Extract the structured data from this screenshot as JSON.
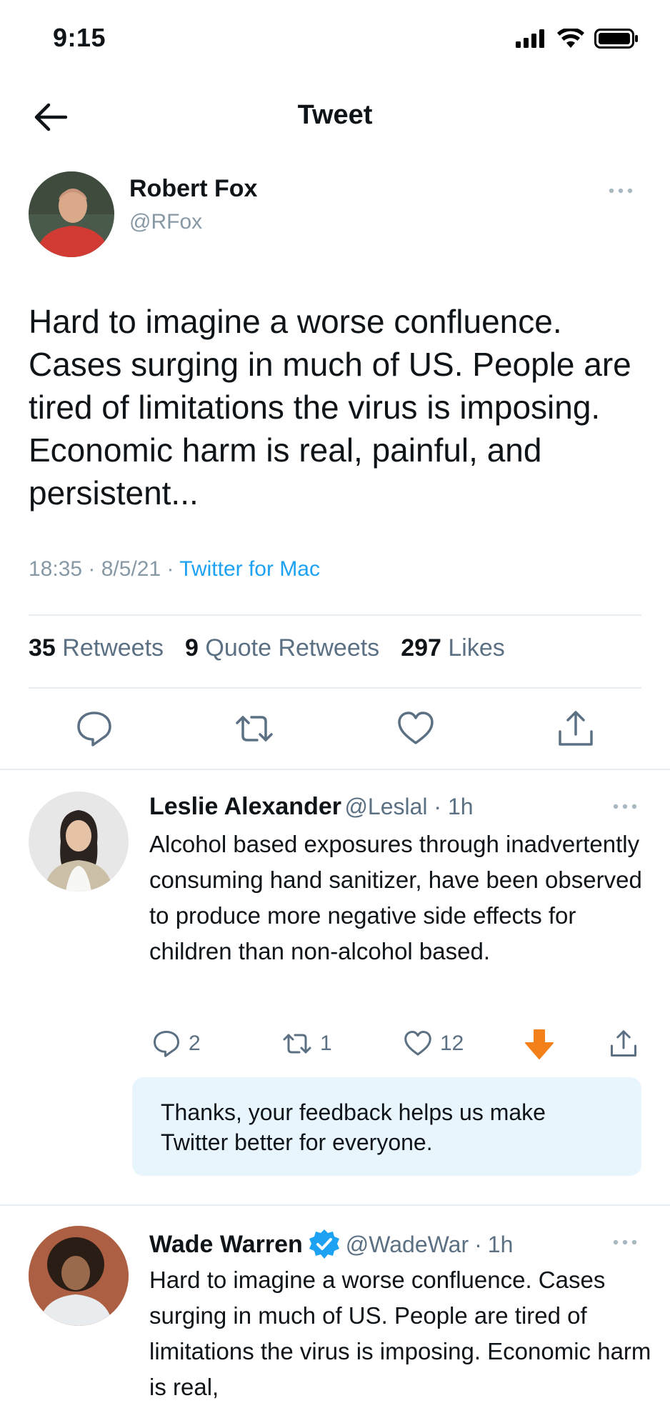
{
  "status_bar": {
    "time": "9:15"
  },
  "header": {
    "title": "Tweet"
  },
  "tweet": {
    "author_name": "Robert Fox",
    "author_handle": "@RFox",
    "text": "Hard to imagine a worse confluence. Cases surging in much of US. People are tired of limitations the virus is imposing. Economic harm is real, painful, and persistent...",
    "time": "18:35",
    "date": "8/5/21",
    "source": "Twitter for Mac",
    "retweets_count": "35",
    "retweets_label": "Retweets",
    "quote_count": "9",
    "quote_label": "Quote Retweets",
    "likes_count": "297",
    "likes_label": "Likes"
  },
  "replies": [
    {
      "name": "Leslie Alexander",
      "handle": "@Leslal",
      "time": "1h",
      "text": "Alcohol based exposures through inadvertently consuming hand sanitizer, have been observed to produce more negative side effects for children than non-alcohol based.",
      "reply_count": "2",
      "retweet_count": "1",
      "like_count": "12"
    },
    {
      "name": "Wade Warren",
      "handle": "@WadeWar",
      "time": "1h",
      "verified": true,
      "text": "Hard to imagine a worse confluence. Cases surging in much of US. People are tired of limitations the virus is imposing. Economic harm is real,"
    }
  ],
  "feedback": {
    "message": "Thanks, your feedback helps us make Twitter better for everyone."
  },
  "colors": {
    "accent": "#1da1f2",
    "downvote": "#f4801a",
    "muted": "#5b7083",
    "feedback_bg": "#e8f5fd"
  }
}
